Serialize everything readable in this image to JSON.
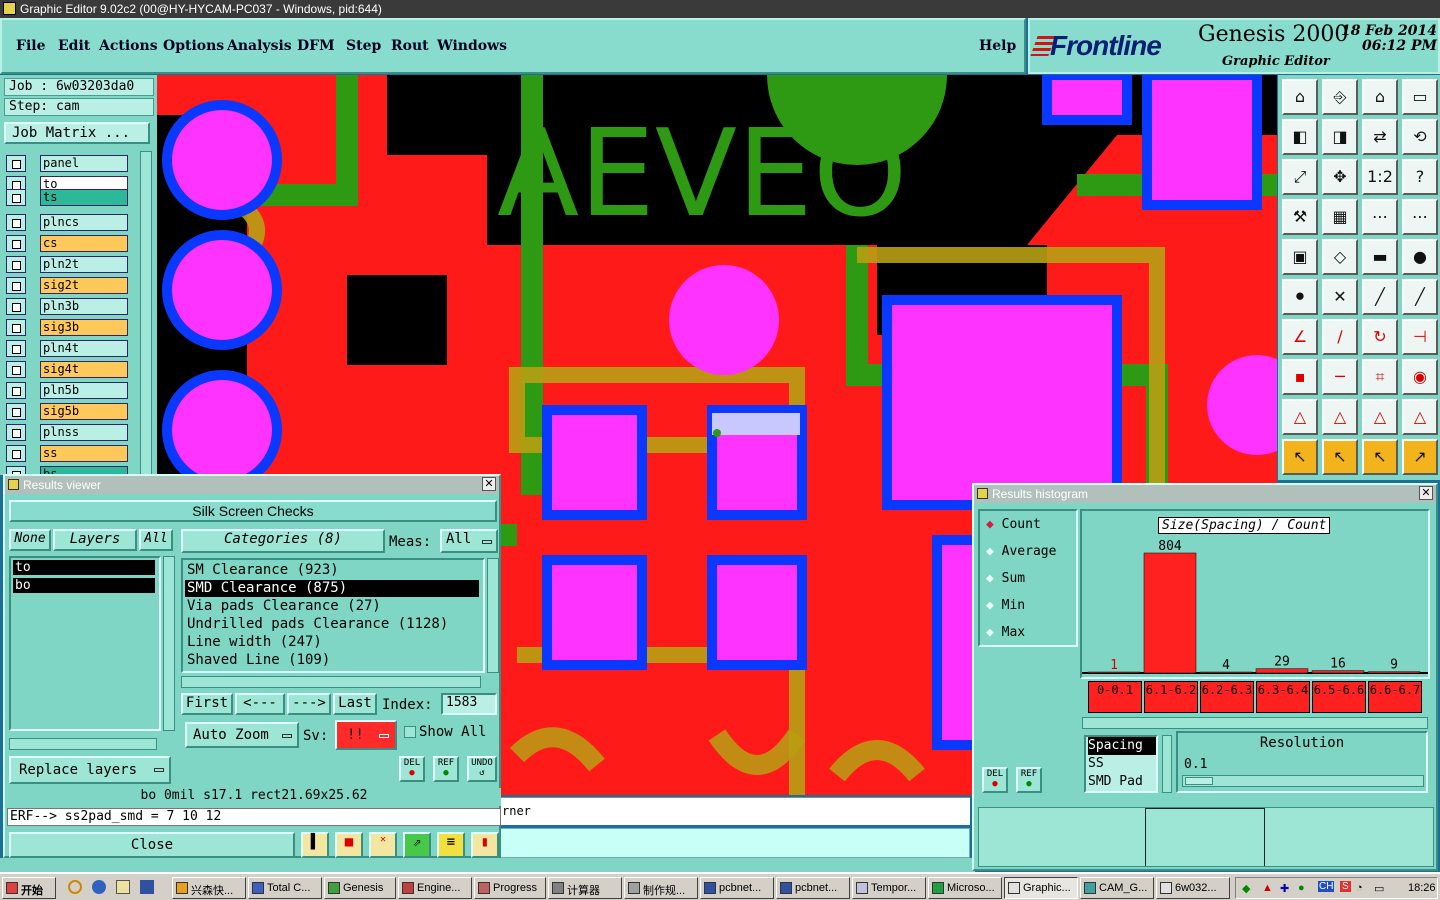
{
  "window": {
    "title": "Graphic Editor 9.02c2 (00@HY-HYCAM-PC037 - Windows, pid:644)"
  },
  "menu": [
    "File",
    "Edit",
    "Actions",
    "Options",
    "Analysis",
    "DFM",
    "Step",
    "Rout",
    "Windows"
  ],
  "help_label": "Help",
  "branding": {
    "logo": "Frontline",
    "product": "Genesis 2000",
    "subtitle": "Graphic Editor",
    "date": "18 Feb 2014",
    "time": "06:12 PM"
  },
  "job": {
    "job_line": "Job : 6w03203da0",
    "step_line": "Step: cam",
    "matrix_button": "Job Matrix ..."
  },
  "layers": [
    {
      "name": "panel",
      "color": "#b9efe4"
    },
    {
      "name": "to",
      "color": "#ffffff"
    },
    {
      "name": "ts",
      "color": "#2eb89a"
    },
    {
      "name": "plncs",
      "color": "#b9efe4"
    },
    {
      "name": "cs",
      "color": "#ffc85a"
    },
    {
      "name": "pln2t",
      "color": "#b9efe4"
    },
    {
      "name": "sig2t",
      "color": "#ffc85a"
    },
    {
      "name": "pln3b",
      "color": "#b9efe4"
    },
    {
      "name": "sig3b",
      "color": "#ffc85a"
    },
    {
      "name": "pln4t",
      "color": "#b9efe4"
    },
    {
      "name": "sig4t",
      "color": "#ffc85a"
    },
    {
      "name": "pln5b",
      "color": "#b9efe4"
    },
    {
      "name": "sig5b",
      "color": "#ffc85a"
    },
    {
      "name": "plnss",
      "color": "#b9efe4"
    },
    {
      "name": "ss",
      "color": "#ffc85a"
    },
    {
      "name": "bs",
      "color": "#2eb89a"
    }
  ],
  "canvas": {
    "silk_text": "AEVEO",
    "status_tail": "rner"
  },
  "results_viewer": {
    "title": "Results viewer",
    "header": "Silk Screen Checks",
    "none_btn": "None",
    "layers_btn": "Layers",
    "all_btn": "All",
    "layer_items": [
      "to",
      "bo"
    ],
    "categories_label": "Categories  (8)",
    "meas_label": "Meas:",
    "meas_value": "All",
    "categories": [
      "SM Clearance (923)",
      "SMD Clearance (875)",
      "Via pads Clearance (27)",
      "Undrilled pads Clearance (1128)",
      "Line width (247)",
      "Shaved Line (109)"
    ],
    "selected_category": "SMD Clearance (875)",
    "nav": {
      "first": "First",
      "prev": "<---",
      "next": "--->",
      "last": "Last",
      "index_label": "Index:",
      "index_value": "1583"
    },
    "auto_zoom": "Auto Zoom",
    "sv_label": "Sv:",
    "sv_value": "!!",
    "show_all": "Show All",
    "del": "DEL",
    "ref": "REF",
    "undo": "UNDO",
    "replace_layers": "Replace layers",
    "info_line": "bo 0mil   s17.1   rect21.69x25.62",
    "erf_line": "ERF--> ss2pad_smd = 7 10 12",
    "close": "Close"
  },
  "results_histogram": {
    "title": "Results histogram",
    "modes": [
      "Count",
      "Average",
      "Sum",
      "Min",
      "Max"
    ],
    "selected_mode": "Count",
    "del": "DEL",
    "ref": "REF",
    "resolution_label": "Resolution",
    "resolution_value": "0.1",
    "filters": [
      "Spacing",
      "SS",
      "SMD Pad"
    ],
    "chart_data": {
      "type": "bar",
      "title": "Size(Spacing) / Count",
      "categories": [
        "0-0.1",
        "6.1-6.2",
        "6.2-6.3",
        "6.3-6.4",
        "6.5-6.6",
        "6.6-6.7"
      ],
      "values": [
        1,
        804,
        4,
        29,
        16,
        9
      ],
      "ylim": [
        0,
        804
      ],
      "bar_color": "#ff2020"
    }
  },
  "taskbar": {
    "start": "开始",
    "tasks": [
      "兴森快...",
      "Total C...",
      "Genesis",
      "Engine...",
      "Progress",
      "计算器",
      "制作规...",
      "pcbnet...",
      "pcbnet...",
      "Tempor...",
      "Microso...",
      "Graphic...",
      "CAM_G...",
      "6w032..."
    ],
    "active_task": "Graphic...",
    "tray_lang": "CH",
    "clock": "18:26"
  }
}
